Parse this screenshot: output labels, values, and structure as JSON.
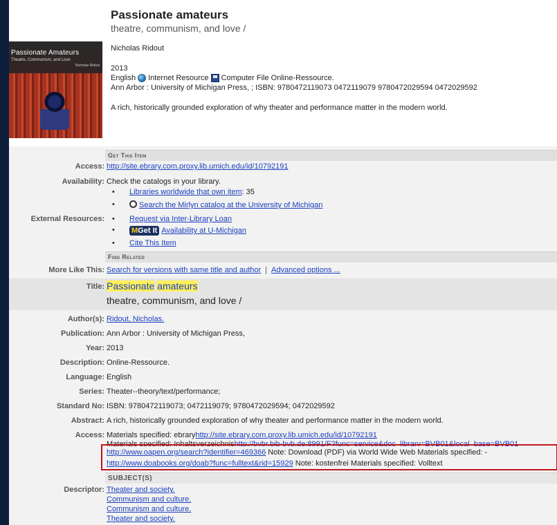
{
  "header": {
    "cover_title": "Passionate Amateurs",
    "cover_subtitle": "Theatre, Communism, and Love",
    "cover_author": "Nicholas Ridout",
    "title": "Passionate amateurs",
    "subtitle": "theatre, communism, and love /",
    "author": "Nicholas Ridout",
    "year": "2013",
    "language": "English",
    "format1": "Internet Resource",
    "format2": "Computer File Online-Ressource.",
    "publication": "Ann Arbor : University of Michigan Press, ; ISBN: 9780472119073 0472119079 9780472029594 0472029592",
    "abstract": "A rich, historically grounded exploration of why theater and performance matter in the modern world."
  },
  "sections": {
    "get_item": "Get This Item",
    "find_related": "Find Related",
    "subjects": "SUBJECT(S)"
  },
  "labels": {
    "access": "Access:",
    "availability": "Availability:",
    "external": "External Resources:",
    "more_like": "More Like This:",
    "title": "Title:",
    "authors": "Author(s):",
    "publication": "Publication:",
    "year": "Year:",
    "description": "Description:",
    "language": "Language:",
    "series": "Series:",
    "standard_no": "Standard No:",
    "abstract": "Abstract:",
    "access2": "Access:",
    "descriptor": "Descriptor:"
  },
  "get_item": {
    "access_url": "http://site.ebrary.com.proxy.lib.umich.edu/id/10792191",
    "availability": "Check the catalogs in your library.",
    "libraries_link": "Libraries worldwide that own item",
    "libraries_count": ": 35",
    "mirlyn_link": "Search the Mirlyn catalog at the University of Michigan",
    "ill_link": "Request via Inter-Library Loan",
    "mgetit_label": "Get It",
    "mgetit_m": "M",
    "mgetit_link": "Availability at U-Michigan",
    "cite_link": "Cite This Item"
  },
  "related": {
    "versions_link": "Search for versions with same title and author",
    "separator": "|",
    "advanced_link": "Advanced options ..."
  },
  "details": {
    "title_word1": "Passionate",
    "title_word2": "amateurs",
    "subtitle": "theatre, communism, and love /",
    "authors_link": "Ridout, Nicholas.",
    "publication": "Ann Arbor : University of Michigan Press,",
    "year": "2013",
    "description": "Online-Ressource.",
    "language": "English",
    "series": "Theater--theory/text/performance;",
    "standard_no": "ISBN: 9780472119073; 0472119079; 9780472029594; 0472029592",
    "abstract": "A rich, historically grounded exploration of why theater and performance matter in the modern world.",
    "access_line1_prefix": "Materials specified: ebrary",
    "access_line1_link": "http://site.ebrary.com.proxy.lib.umich.edu/id/10792191",
    "access_line2_prefix": "Materials specified: Inhaltsverzeichnis",
    "access_line2_link": "http://bvbr.bib-bvb.de:8991/F?func=service&doc_library=BVB01&local_base=BVB01",
    "oapen_link": "http://www.oapen.org/search?identifier=469366",
    "oapen_note": " Note: Download (PDF) via World Wide Web Materials specified: -",
    "doab_link": "http://www.doabooks.org/doab?func=fulltext&rid=15929",
    "doab_note": " Note: kostenfrei Materials specified: Volltext"
  },
  "subjects": [
    "Theater and society.",
    "Communism and culture.",
    "Communism and culture.",
    "Theater and society."
  ]
}
